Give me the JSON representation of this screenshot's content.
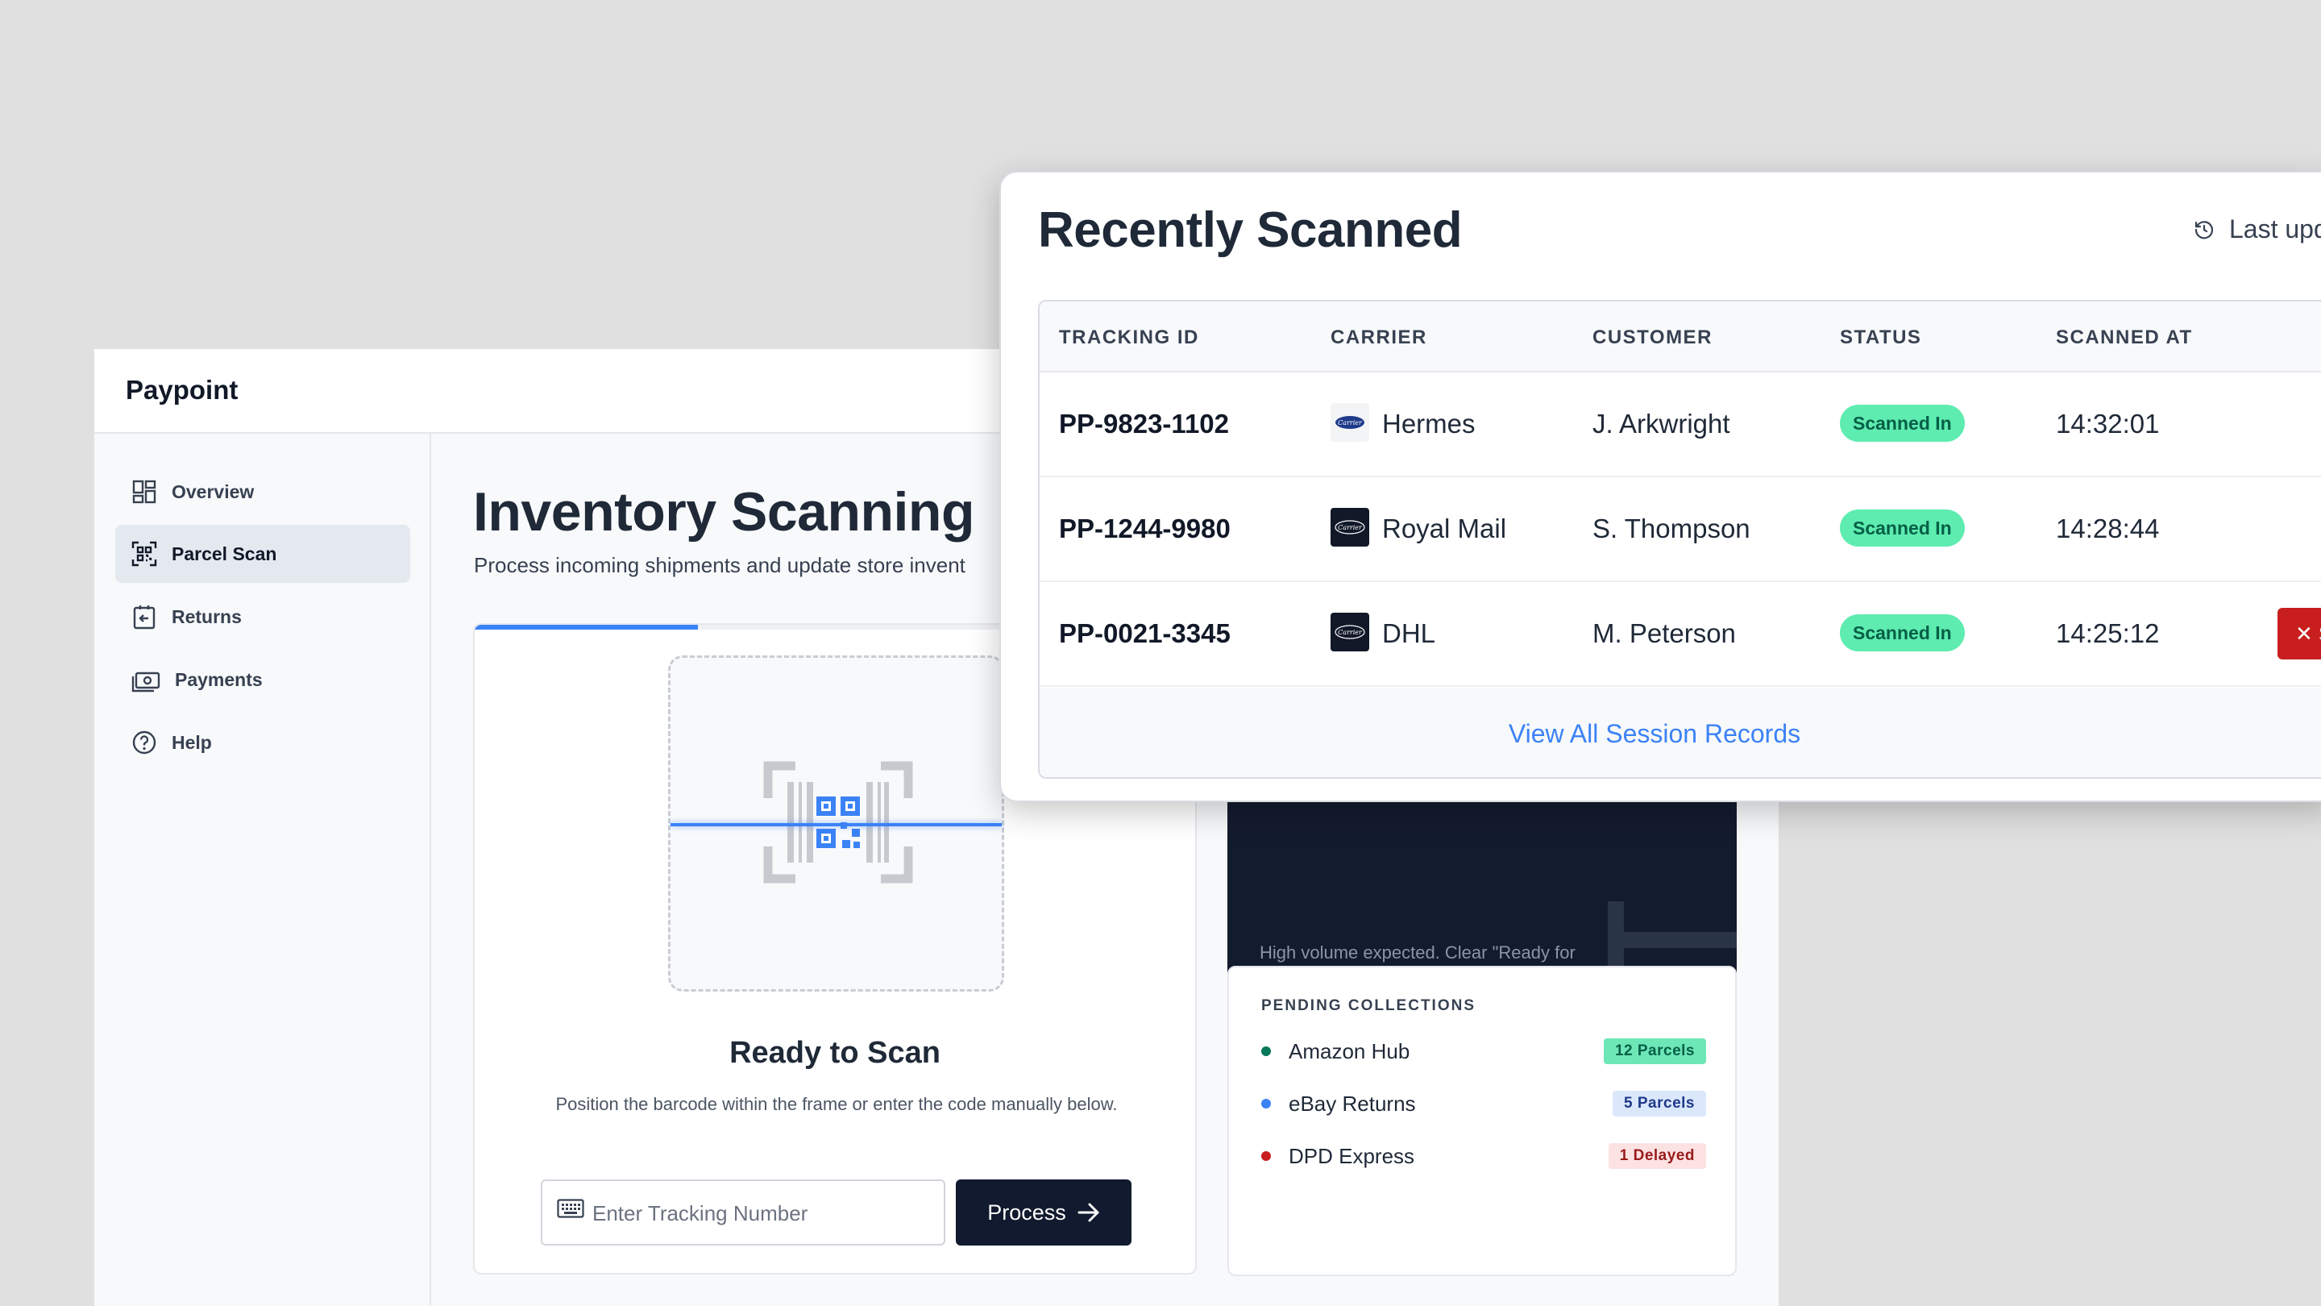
{
  "app": {
    "brand": "Paypoint"
  },
  "sidebar": {
    "items": [
      {
        "label": "Overview",
        "icon": "dashboard-grid-icon"
      },
      {
        "label": "Parcel Scan",
        "icon": "qr-scan-icon",
        "active": true
      },
      {
        "label": "Returns",
        "icon": "return-box-icon"
      },
      {
        "label": "Payments",
        "icon": "cash-icon"
      },
      {
        "label": "Help",
        "icon": "help-circle-icon"
      }
    ]
  },
  "main": {
    "title": "Inventory Scanning",
    "subtitle": "Process incoming shipments and update store invent",
    "scanner": {
      "progress": 0.31,
      "ready_title": "Ready to Scan",
      "ready_desc": "Position the barcode within the frame or enter the code manually below.",
      "input_placeholder": "Enter Tracking Number",
      "input_value": "",
      "process_label": "Process"
    },
    "alert": {
      "desc": "High volume expected. Clear \"Ready for Collection\" parcels soon."
    },
    "pending": {
      "heading": "PENDING COLLECTIONS",
      "items": [
        {
          "label": "Amazon Hub",
          "badge": "12 Parcels",
          "dot": "#047857",
          "badge_bg": "#6ee7b7",
          "badge_fg": "#065f46"
        },
        {
          "label": "eBay Returns",
          "badge": "5 Parcels",
          "dot": "#3b82f6",
          "badge_bg": "#dbe7fb",
          "badge_fg": "#1e3a8a"
        },
        {
          "label": "DPD Express",
          "badge": "1 Delayed",
          "dot": "#c81e1e",
          "badge_bg": "#fde2e2",
          "badge_fg": "#991b1b"
        }
      ]
    }
  },
  "overlay": {
    "title": "Recently Scanned",
    "last_updated": "Last upd",
    "columns": [
      "TRACKING ID",
      "CARRIER",
      "CUSTOMER",
      "STATUS",
      "SCANNED AT"
    ],
    "rows": [
      {
        "tracking_id": "PP-9823-1102",
        "carrier": "Hermes",
        "logo_bg": "#f3f4f6",
        "logo_fg": "#1e3a8a",
        "customer": "J. Arkwright",
        "status": "Scanned In",
        "scanned_at": "14:32:01"
      },
      {
        "tracking_id": "PP-1244-9980",
        "carrier": "Royal Mail",
        "logo_bg": "#111827",
        "logo_fg": "#ffffff",
        "customer": "S. Thompson",
        "status": "Scanned In",
        "scanned_at": "14:28:44"
      },
      {
        "tracking_id": "PP-0021-3345",
        "carrier": "DHL",
        "logo_bg": "#111827",
        "logo_fg": "#ffffff",
        "customer": "M. Peterson",
        "status": "Scanned In",
        "scanned_at": "14:25:12"
      }
    ],
    "logo_text": "Carrier",
    "danger_label": "✕ S",
    "view_all": "View All Session Records"
  },
  "colors": {
    "accent": "#3b82f6",
    "dark": "#111a2e",
    "status_green": "#5eecb0",
    "danger": "#c81e1e"
  }
}
